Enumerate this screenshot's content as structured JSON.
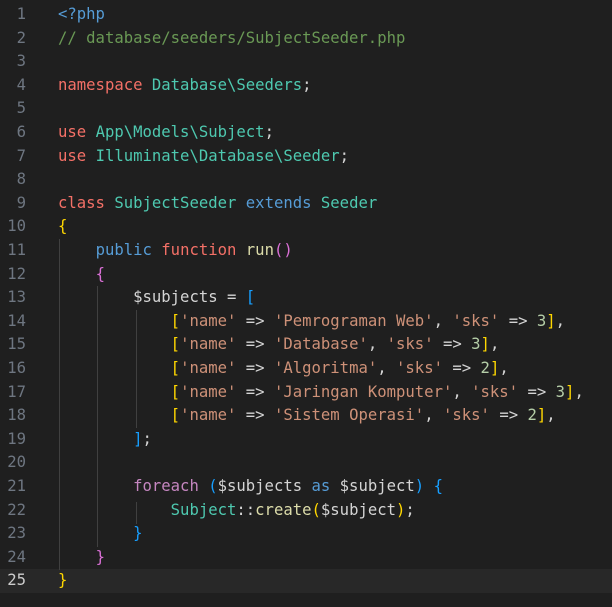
{
  "editor": {
    "language": "php",
    "current_line": 25,
    "colors": {
      "background": "#1f1f1f",
      "current_line": "#282828",
      "line_number": "#6e7681",
      "keyword": "#f47067",
      "type": "#4ec9b0",
      "function": "#dcdcaa",
      "string": "#ce9178",
      "number": "#b5cea8",
      "bracket_level_1": "#ffd700",
      "bracket_level_2": "#da70d6",
      "bracket_level_3": "#179fff"
    },
    "lines": [
      {
        "n": "1",
        "tokens": [
          [
            "t-tag",
            "<?php"
          ]
        ]
      },
      {
        "n": "2",
        "tokens": [
          [
            "t-com",
            "// database/seeders/SubjectSeeder.php"
          ]
        ]
      },
      {
        "n": "3",
        "tokens": []
      },
      {
        "n": "4",
        "tokens": [
          [
            "t-key",
            "namespace"
          ],
          [
            "t-plain",
            " "
          ],
          [
            "t-ns",
            "Database\\Seeders"
          ],
          [
            "t-plain",
            ";"
          ]
        ]
      },
      {
        "n": "5",
        "tokens": []
      },
      {
        "n": "6",
        "tokens": [
          [
            "t-key",
            "use"
          ],
          [
            "t-plain",
            " "
          ],
          [
            "t-ns",
            "App\\Models\\Subject"
          ],
          [
            "t-plain",
            ";"
          ]
        ]
      },
      {
        "n": "7",
        "tokens": [
          [
            "t-key",
            "use"
          ],
          [
            "t-plain",
            " "
          ],
          [
            "t-ns",
            "Illuminate\\Database\\Seeder"
          ],
          [
            "t-plain",
            ";"
          ]
        ]
      },
      {
        "n": "8",
        "tokens": []
      },
      {
        "n": "9",
        "tokens": [
          [
            "t-key",
            "class"
          ],
          [
            "t-plain",
            " "
          ],
          [
            "t-cls",
            "SubjectSeeder"
          ],
          [
            "t-plain",
            " "
          ],
          [
            "t-blue",
            "extends"
          ],
          [
            "t-plain",
            " "
          ],
          [
            "t-cls",
            "Seeder"
          ]
        ]
      },
      {
        "n": "10",
        "tokens": [
          [
            "b1",
            "{"
          ]
        ]
      },
      {
        "n": "11",
        "tokens": [
          [
            "t-plain",
            "    "
          ],
          [
            "t-blue",
            "public"
          ],
          [
            "t-plain",
            " "
          ],
          [
            "t-key",
            "function"
          ],
          [
            "t-plain",
            " "
          ],
          [
            "t-fn",
            "run"
          ],
          [
            "b2",
            "()"
          ]
        ]
      },
      {
        "n": "12",
        "tokens": [
          [
            "t-plain",
            "    "
          ],
          [
            "b2",
            "{"
          ]
        ]
      },
      {
        "n": "13",
        "tokens": [
          [
            "t-plain",
            "        "
          ],
          [
            "t-var",
            "$subjects"
          ],
          [
            "t-plain",
            " "
          ],
          [
            "t-op",
            "="
          ],
          [
            "t-plain",
            " "
          ],
          [
            "b3",
            "["
          ]
        ]
      },
      {
        "n": "14",
        "tokens": [
          [
            "t-plain",
            "            "
          ],
          [
            "b1",
            "["
          ],
          [
            "t-str",
            "'name'"
          ],
          [
            "t-plain",
            " "
          ],
          [
            "t-op",
            "=>"
          ],
          [
            "t-plain",
            " "
          ],
          [
            "t-str",
            "'Pemrograman Web'"
          ],
          [
            "t-plain",
            ", "
          ],
          [
            "t-str",
            "'sks'"
          ],
          [
            "t-plain",
            " "
          ],
          [
            "t-op",
            "=>"
          ],
          [
            "t-plain",
            " "
          ],
          [
            "t-num",
            "3"
          ],
          [
            "b1",
            "]"
          ],
          [
            "t-plain",
            ","
          ]
        ]
      },
      {
        "n": "15",
        "tokens": [
          [
            "t-plain",
            "            "
          ],
          [
            "b1",
            "["
          ],
          [
            "t-str",
            "'name'"
          ],
          [
            "t-plain",
            " "
          ],
          [
            "t-op",
            "=>"
          ],
          [
            "t-plain",
            " "
          ],
          [
            "t-str",
            "'Database'"
          ],
          [
            "t-plain",
            ", "
          ],
          [
            "t-str",
            "'sks'"
          ],
          [
            "t-plain",
            " "
          ],
          [
            "t-op",
            "=>"
          ],
          [
            "t-plain",
            " "
          ],
          [
            "t-num",
            "3"
          ],
          [
            "b1",
            "]"
          ],
          [
            "t-plain",
            ","
          ]
        ]
      },
      {
        "n": "16",
        "tokens": [
          [
            "t-plain",
            "            "
          ],
          [
            "b1",
            "["
          ],
          [
            "t-str",
            "'name'"
          ],
          [
            "t-plain",
            " "
          ],
          [
            "t-op",
            "=>"
          ],
          [
            "t-plain",
            " "
          ],
          [
            "t-str",
            "'Algoritma'"
          ],
          [
            "t-plain",
            ", "
          ],
          [
            "t-str",
            "'sks'"
          ],
          [
            "t-plain",
            " "
          ],
          [
            "t-op",
            "=>"
          ],
          [
            "t-plain",
            " "
          ],
          [
            "t-num",
            "2"
          ],
          [
            "b1",
            "]"
          ],
          [
            "t-plain",
            ","
          ]
        ]
      },
      {
        "n": "17",
        "tokens": [
          [
            "t-plain",
            "            "
          ],
          [
            "b1",
            "["
          ],
          [
            "t-str",
            "'name'"
          ],
          [
            "t-plain",
            " "
          ],
          [
            "t-op",
            "=>"
          ],
          [
            "t-plain",
            " "
          ],
          [
            "t-str",
            "'Jaringan Komputer'"
          ],
          [
            "t-plain",
            ", "
          ],
          [
            "t-str",
            "'sks'"
          ],
          [
            "t-plain",
            " "
          ],
          [
            "t-op",
            "=>"
          ],
          [
            "t-plain",
            " "
          ],
          [
            "t-num",
            "3"
          ],
          [
            "b1",
            "]"
          ],
          [
            "t-plain",
            ","
          ]
        ]
      },
      {
        "n": "18",
        "tokens": [
          [
            "t-plain",
            "            "
          ],
          [
            "b1",
            "["
          ],
          [
            "t-str",
            "'name'"
          ],
          [
            "t-plain",
            " "
          ],
          [
            "t-op",
            "=>"
          ],
          [
            "t-plain",
            " "
          ],
          [
            "t-str",
            "'Sistem Operasi'"
          ],
          [
            "t-plain",
            ", "
          ],
          [
            "t-str",
            "'sks'"
          ],
          [
            "t-plain",
            " "
          ],
          [
            "t-op",
            "=>"
          ],
          [
            "t-plain",
            " "
          ],
          [
            "t-num",
            "2"
          ],
          [
            "b1",
            "]"
          ],
          [
            "t-plain",
            ","
          ]
        ]
      },
      {
        "n": "19",
        "tokens": [
          [
            "t-plain",
            "        "
          ],
          [
            "b3",
            "]"
          ],
          [
            "t-plain",
            ";"
          ]
        ]
      },
      {
        "n": "20",
        "tokens": []
      },
      {
        "n": "21",
        "tokens": [
          [
            "t-plain",
            "        "
          ],
          [
            "t-ctl",
            "foreach"
          ],
          [
            "t-plain",
            " "
          ],
          [
            "b3",
            "("
          ],
          [
            "t-var",
            "$subjects"
          ],
          [
            "t-plain",
            " "
          ],
          [
            "t-blue",
            "as"
          ],
          [
            "t-plain",
            " "
          ],
          [
            "t-var",
            "$subject"
          ],
          [
            "b3",
            ")"
          ],
          [
            "t-plain",
            " "
          ],
          [
            "b3",
            "{"
          ]
        ]
      },
      {
        "n": "22",
        "tokens": [
          [
            "t-plain",
            "            "
          ],
          [
            "t-cls",
            "Subject"
          ],
          [
            "t-plain",
            "::"
          ],
          [
            "t-fn",
            "create"
          ],
          [
            "b1",
            "("
          ],
          [
            "t-var",
            "$subject"
          ],
          [
            "b1",
            ")"
          ],
          [
            "t-plain",
            ";"
          ]
        ]
      },
      {
        "n": "23",
        "tokens": [
          [
            "t-plain",
            "        "
          ],
          [
            "b3",
            "}"
          ]
        ]
      },
      {
        "n": "24",
        "tokens": [
          [
            "t-plain",
            "    "
          ],
          [
            "b2",
            "}"
          ]
        ]
      },
      {
        "n": "25",
        "tokens": [
          [
            "b1",
            "}"
          ]
        ]
      }
    ]
  }
}
